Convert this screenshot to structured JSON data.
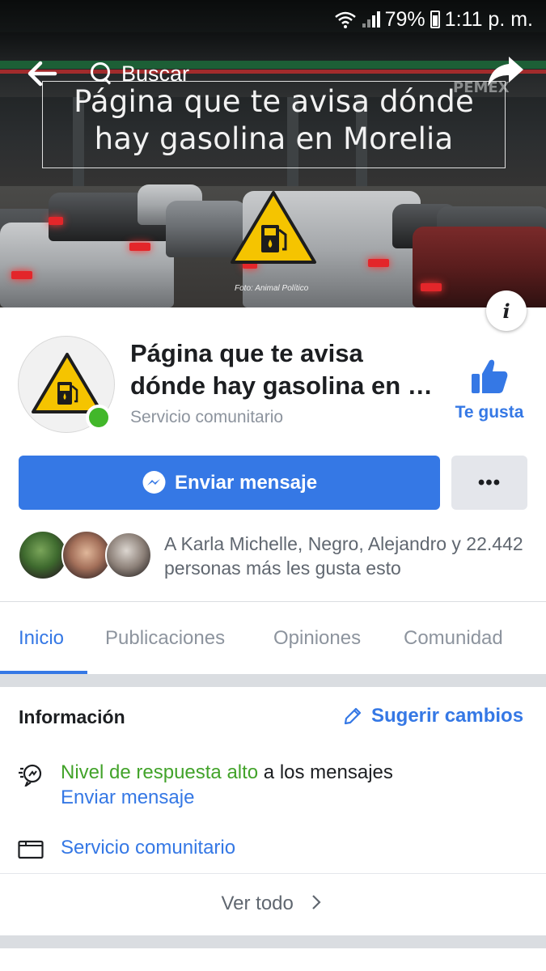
{
  "status_bar": {
    "battery": "79%",
    "time": "1:11 p. m."
  },
  "top_nav": {
    "search_label": "Buscar"
  },
  "cover": {
    "title_line1": "Página que te avisa dónde",
    "title_line2": "hay gasolina en Morelia",
    "brand": "PEMEX",
    "credit": "Foto: Animal Político"
  },
  "page": {
    "name": "Página que te avisa dónde hay gasolina en …",
    "category": "Servicio comunitario",
    "like_label": "Te gusta"
  },
  "actions": {
    "message_label": "Enviar mensaje",
    "more_label": "•••"
  },
  "friends_text": "A Karla Michelle, Negro, Alejandro y 22.442 personas más les gusta esto",
  "tabs": [
    {
      "label": "Inicio",
      "active": true
    },
    {
      "label": "Publicaciones",
      "active": false
    },
    {
      "label": "Opiniones",
      "active": false
    },
    {
      "label": "Comunidad",
      "active": false
    }
  ],
  "info": {
    "heading": "Información",
    "suggest_label": "Sugerir cambios",
    "response_highlight": "Nivel de respuesta alto",
    "response_rest": " a los mensajes",
    "response_link": "Enviar mensaje",
    "category_link": "Servicio comunitario",
    "see_all": "Ver todo"
  },
  "colors": {
    "accent": "#3578e5",
    "online": "#42b72a",
    "response_green": "#42a32a",
    "warning_yellow": "#f5c400"
  }
}
